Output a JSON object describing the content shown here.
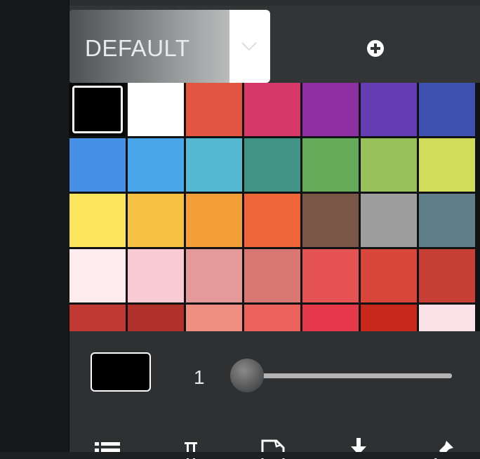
{
  "palette_select": {
    "value": "DEFAULT"
  },
  "add_palette": {
    "icon": "plus-circle-icon"
  },
  "swatches": [
    [
      "#000000",
      "#ffffff",
      "#e25541",
      "#d6386a",
      "#8e2fa4",
      "#653db2",
      "#3f51b0"
    ],
    [
      "#4790e8",
      "#48a6e9",
      "#54b8d0",
      "#409385",
      "#66ab5a",
      "#96c059",
      "#d0dc5a"
    ],
    [
      "#fbe55c",
      "#f4c142",
      "#f19f36",
      "#ee6638",
      "#795646",
      "#9e9e9e",
      "#607d8a"
    ],
    [
      "#fdebee",
      "#f7cbd1",
      "#e4999a",
      "#d97873",
      "#e55353",
      "#d84539",
      "#c73e34"
    ],
    [
      "#c13932",
      "#b0302a",
      "#ef8e83",
      "#ed625c",
      "#e6384b",
      "#c6281c",
      "#fbe2e8"
    ]
  ],
  "stroke": {
    "width_label": "1",
    "level": 0.0
  },
  "current_color": "#000000",
  "toolbar": [
    "list-icon",
    "pi-icon",
    "book-icon",
    "download-icon",
    "pin-icon"
  ],
  "colors": {
    "panel": "#2c2d2e",
    "top_bar": "#333435",
    "rail": "#16181a"
  }
}
